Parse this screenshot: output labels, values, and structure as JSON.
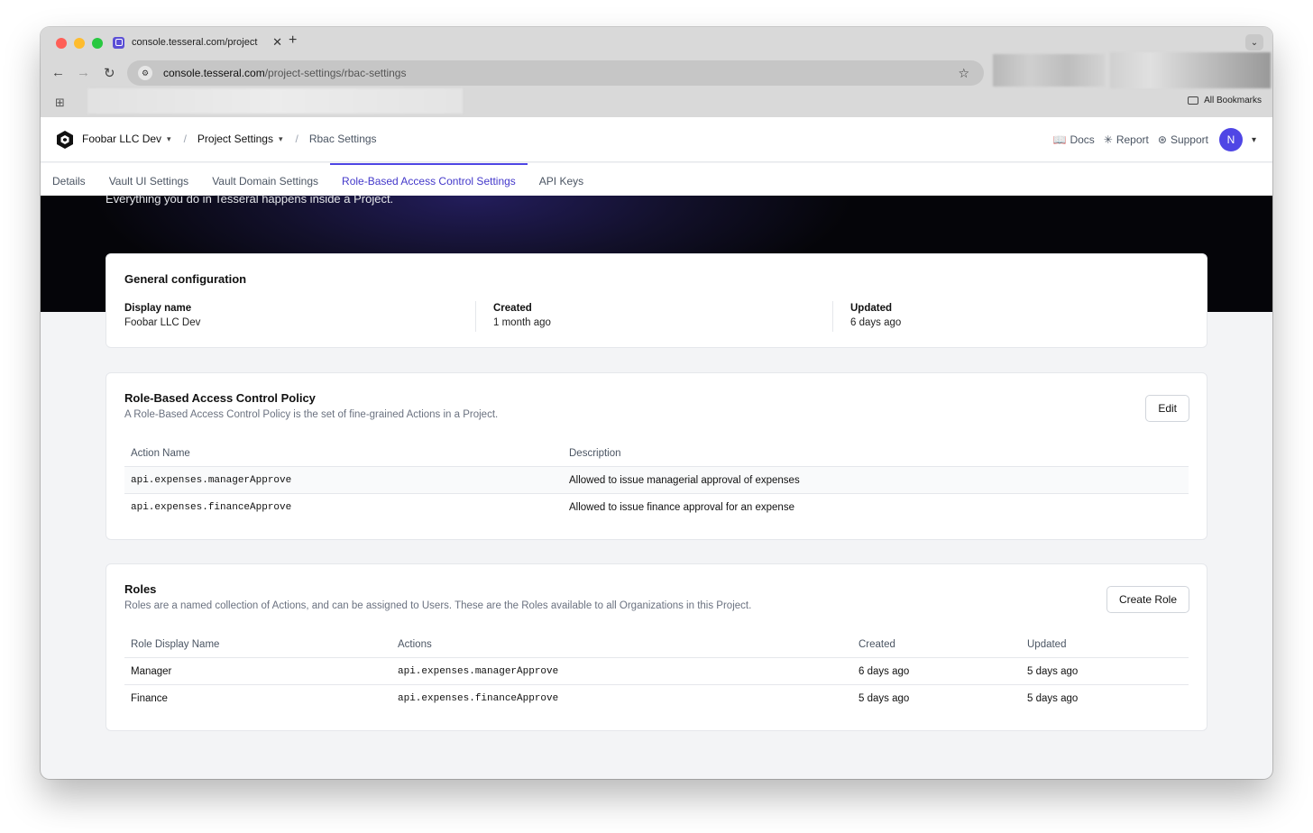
{
  "browser": {
    "tab_title": "console.tesseral.com/project",
    "url_host": "console.tesseral.com",
    "url_path": "/project-settings/rbac-settings",
    "all_bookmarks": "All Bookmarks"
  },
  "header": {
    "project": "Foobar LLC Dev",
    "section": "Project Settings",
    "page": "Rbac Settings",
    "docs": "Docs",
    "report": "Report",
    "support": "Support",
    "avatar_initial": "N"
  },
  "tabs": [
    "Details",
    "Vault UI Settings",
    "Vault Domain Settings",
    "Role-Based Access Control Settings",
    "API Keys"
  ],
  "hero": {
    "subtitle": "Everything you do in Tesseral happens inside a Project."
  },
  "general": {
    "title": "General configuration",
    "display_name_label": "Display name",
    "display_name_value": "Foobar LLC Dev",
    "created_label": "Created",
    "created_value": "1 month ago",
    "updated_label": "Updated",
    "updated_value": "6 days ago"
  },
  "policy": {
    "title": "Role-Based Access Control Policy",
    "description": "A Role-Based Access Control Policy is the set of fine-grained Actions in a Project.",
    "edit_label": "Edit",
    "columns": [
      "Action Name",
      "Description"
    ],
    "rows": [
      [
        "api.expenses.managerApprove",
        "Allowed to issue managerial approval of expenses"
      ],
      [
        "api.expenses.financeApprove",
        "Allowed to issue finance approval for an expense"
      ]
    ]
  },
  "roles": {
    "title": "Roles",
    "description": "Roles are a named collection of Actions, and can be assigned to Users. These are the Roles available to all Organizations in this Project.",
    "create_label": "Create Role",
    "columns": [
      "Role Display Name",
      "Actions",
      "Created",
      "Updated"
    ],
    "rows": [
      [
        "Manager",
        "api.expenses.managerApprove",
        "6 days ago",
        "5 days ago"
      ],
      [
        "Finance",
        "api.expenses.financeApprove",
        "5 days ago",
        "5 days ago"
      ]
    ]
  },
  "colors": {
    "accent": "#4f46e5",
    "hero_bg": "#050509"
  }
}
